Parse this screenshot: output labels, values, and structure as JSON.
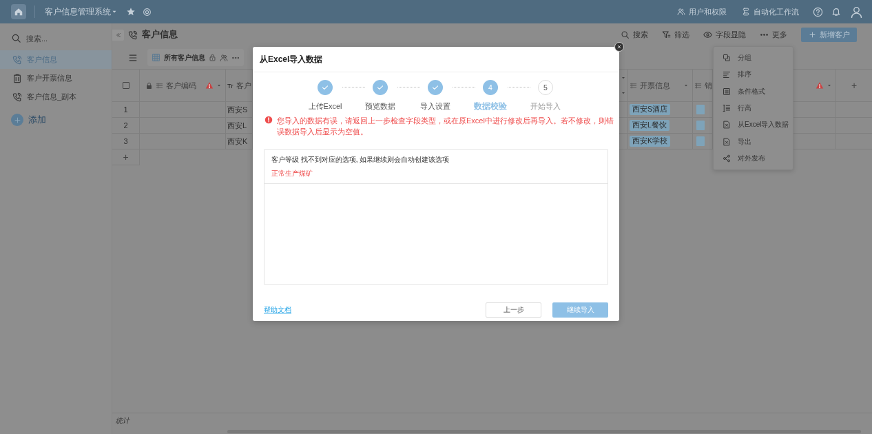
{
  "top_bar": {
    "app_name": "客户信息管理系统",
    "links": [
      {
        "label": "用户和权限"
      },
      {
        "label": "自动化工作流"
      }
    ]
  },
  "sidebar": {
    "search": {
      "placeholder": "搜索..."
    },
    "items": [
      {
        "label": "客户信息",
        "selected": true
      },
      {
        "label": "客户开票信息",
        "selected": false
      },
      {
        "label": "客户信息_副本",
        "selected": false
      }
    ],
    "add_label": "添加"
  },
  "page": {
    "title": "客户信息",
    "actions": [
      {
        "label": "搜索"
      },
      {
        "label": "筛选"
      },
      {
        "label": "字段显隐"
      },
      {
        "label": "更多"
      }
    ],
    "primary_button": "新增客户"
  },
  "view_tab": {
    "label": "所有客户信息"
  },
  "table": {
    "select_all": {
      "checked": false
    },
    "columns": [
      {
        "kind": "code",
        "label": "客户编码",
        "locked": true,
        "warning": true
      },
      {
        "kind": "name",
        "type_label": "Tr",
        "label": "客户"
      },
      {
        "kind": "cut"
      },
      {
        "kind": "invoice",
        "label": "开票信息"
      },
      {
        "kind": "sales",
        "label": "销"
      },
      {
        "kind": "warning",
        "warning": true
      }
    ],
    "rows": [
      {
        "number": "1",
        "name": "西安S",
        "invoice": "西安S酒店"
      },
      {
        "number": "2",
        "name": "西安L",
        "invoice": "西安L餐饮"
      },
      {
        "number": "3",
        "name": "西安K",
        "invoice": "西安K学校"
      }
    ],
    "add_row": "+",
    "add_column": "+"
  },
  "footer": {
    "label": "统计"
  },
  "more_menu": {
    "items": [
      {
        "label": "分组"
      },
      {
        "label": "排序"
      },
      {
        "label": "条件格式"
      },
      {
        "label": "行高"
      },
      {
        "label": "从Excel导入数据"
      },
      {
        "label": "导出"
      },
      {
        "label": "对外发布"
      }
    ]
  },
  "dialog": {
    "title": "从Excel导入数据",
    "steps": [
      {
        "label": "上传Excel",
        "completed": true,
        "selected": false
      },
      {
        "label": "预览数据",
        "completed": true,
        "selected": false
      },
      {
        "label": "导入设置",
        "completed": true,
        "selected": false
      },
      {
        "label": "数据校验",
        "number": "4",
        "completed": false,
        "selected": true
      },
      {
        "label": "开始导入",
        "number": "5",
        "completed": false,
        "selected": false
      }
    ],
    "error_message": "您导入的数据有误，请返回上一步检查字段类型，或在原Excel中进行修改后再导入。若不修改，则错误数据导入后显示为空值。",
    "issues": [
      {
        "message": "客户等级 找不到对应的选项, 如果继续则会自动创建该选项",
        "value": "正常生产煤矿"
      }
    ],
    "help_link": "帮助文档",
    "buttons": [
      {
        "label": "上一步",
        "kind": "secondary"
      },
      {
        "label": "继续导入",
        "kind": "primary"
      }
    ]
  }
}
